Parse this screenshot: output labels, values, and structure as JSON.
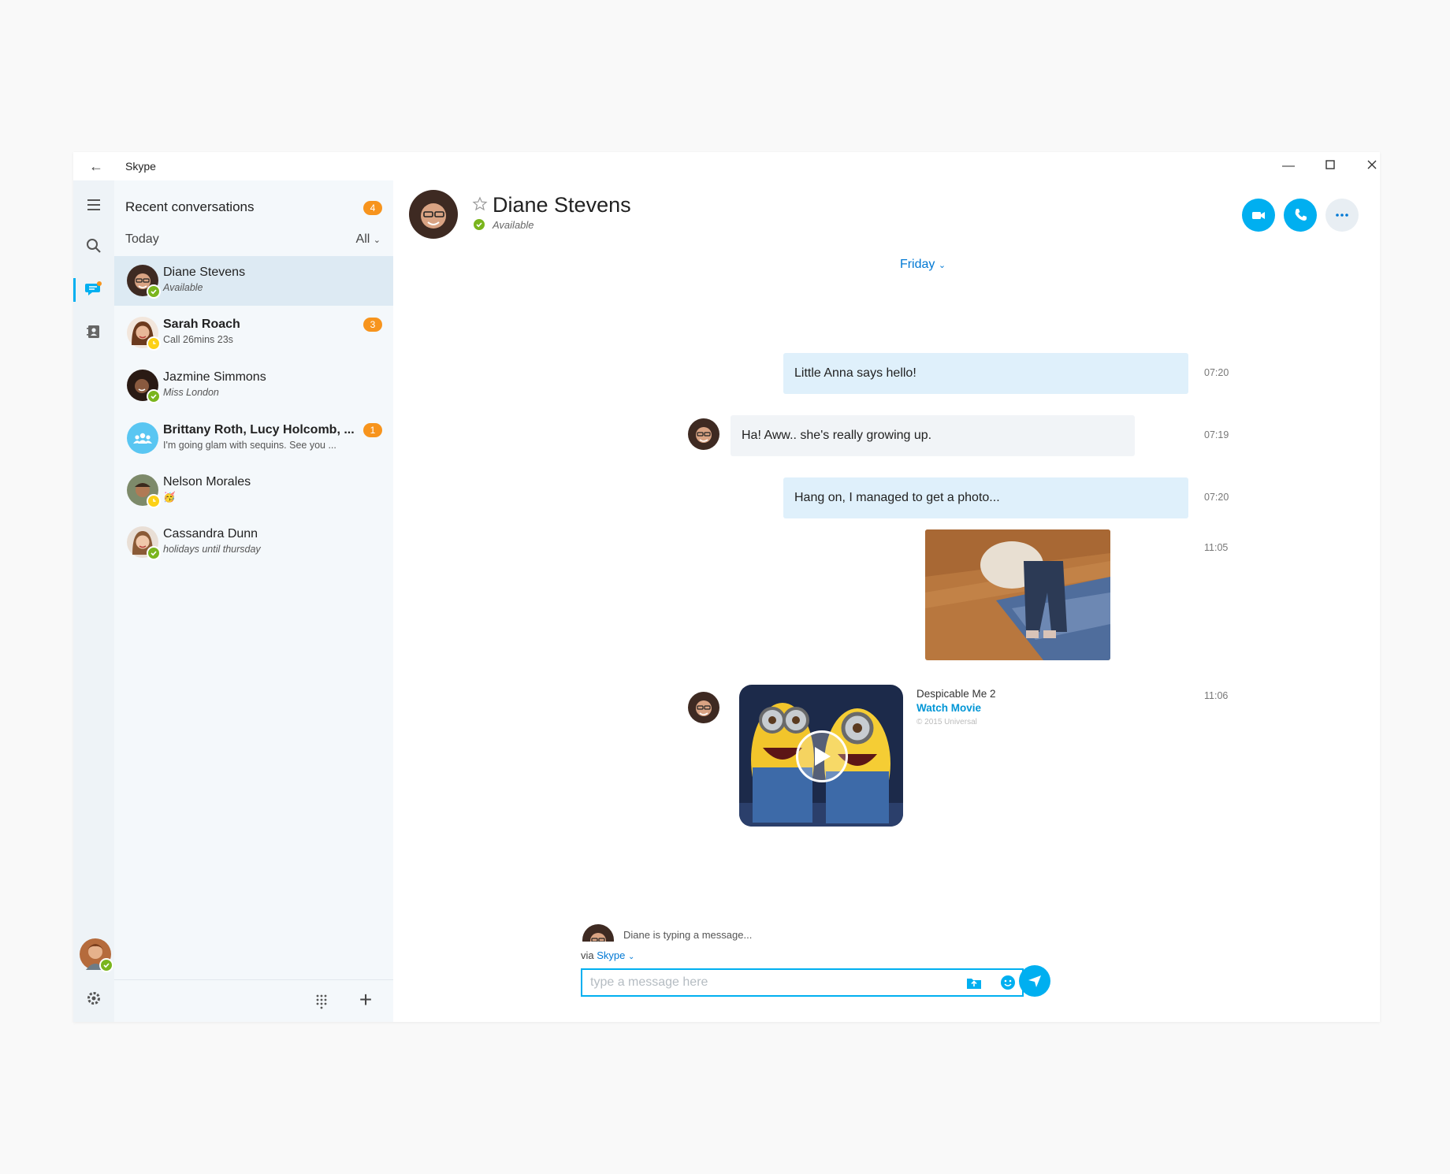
{
  "window": {
    "title": "Skype"
  },
  "sidebar": {
    "heading": "Recent conversations",
    "unread_count": "4",
    "section_label": "Today",
    "filter_label": "All"
  },
  "conversations": [
    {
      "name": "Diane Stevens",
      "sub": "Available",
      "status": "available",
      "badge": ""
    },
    {
      "name": "Sarah Roach",
      "sub": "Call 26mins 23s",
      "status": "away",
      "badge": "3"
    },
    {
      "name": "Jazmine Simmons",
      "sub": "Miss London",
      "status": "available",
      "badge": ""
    },
    {
      "name": "Brittany Roth, Lucy Holcomb, ...",
      "sub": "I'm going glam with sequins. See you ...",
      "status": "group",
      "badge": "1"
    },
    {
      "name": "Nelson Morales",
      "sub": "🥳",
      "status": "away",
      "badge": ""
    },
    {
      "name": "Cassandra Dunn",
      "sub": "holidays until thursday",
      "status": "available",
      "badge": ""
    }
  ],
  "chat": {
    "contact_name": "Diane Stevens",
    "contact_status": "Available",
    "day_separator": "Friday",
    "messages": [
      {
        "from": "me",
        "text": "Little Anna says hello!",
        "time": "07:20"
      },
      {
        "from": "them",
        "text": "Ha! Aww.. she's really growing up.",
        "time": "07:19"
      },
      {
        "from": "me",
        "text": "Hang on, I managed to get a photo...",
        "time": "07:20"
      },
      {
        "from": "me",
        "type": "photo",
        "time": "11:05"
      },
      {
        "from": "them",
        "type": "movie",
        "title": "Despicable Me 2",
        "link": "Watch Movie",
        "copyright": "© 2015 Universal",
        "time": "11:06"
      }
    ],
    "typing_indicator": "Diane is typing a message...",
    "via_prefix": "via",
    "via_service": "Skype",
    "input_placeholder": "type a message here"
  },
  "colors": {
    "accent": "#00aff0",
    "badge": "#f7941d",
    "available": "#7ab51d",
    "away": "#fcd116",
    "bubble_mine": "#dff0fb",
    "bubble_theirs": "#f1f4f7"
  },
  "icons": {
    "rail": [
      "hamburger-menu-icon",
      "search-icon",
      "chat-icon",
      "contacts-icon",
      "settings-icon"
    ],
    "header": [
      "video-call-icon",
      "audio-call-icon",
      "more-icon",
      "favorite-star-icon"
    ],
    "compose": [
      "send-file-icon",
      "emoticon-icon",
      "send-icon"
    ],
    "list_footer": [
      "dialpad-icon",
      "new-chat-plus-icon"
    ]
  }
}
